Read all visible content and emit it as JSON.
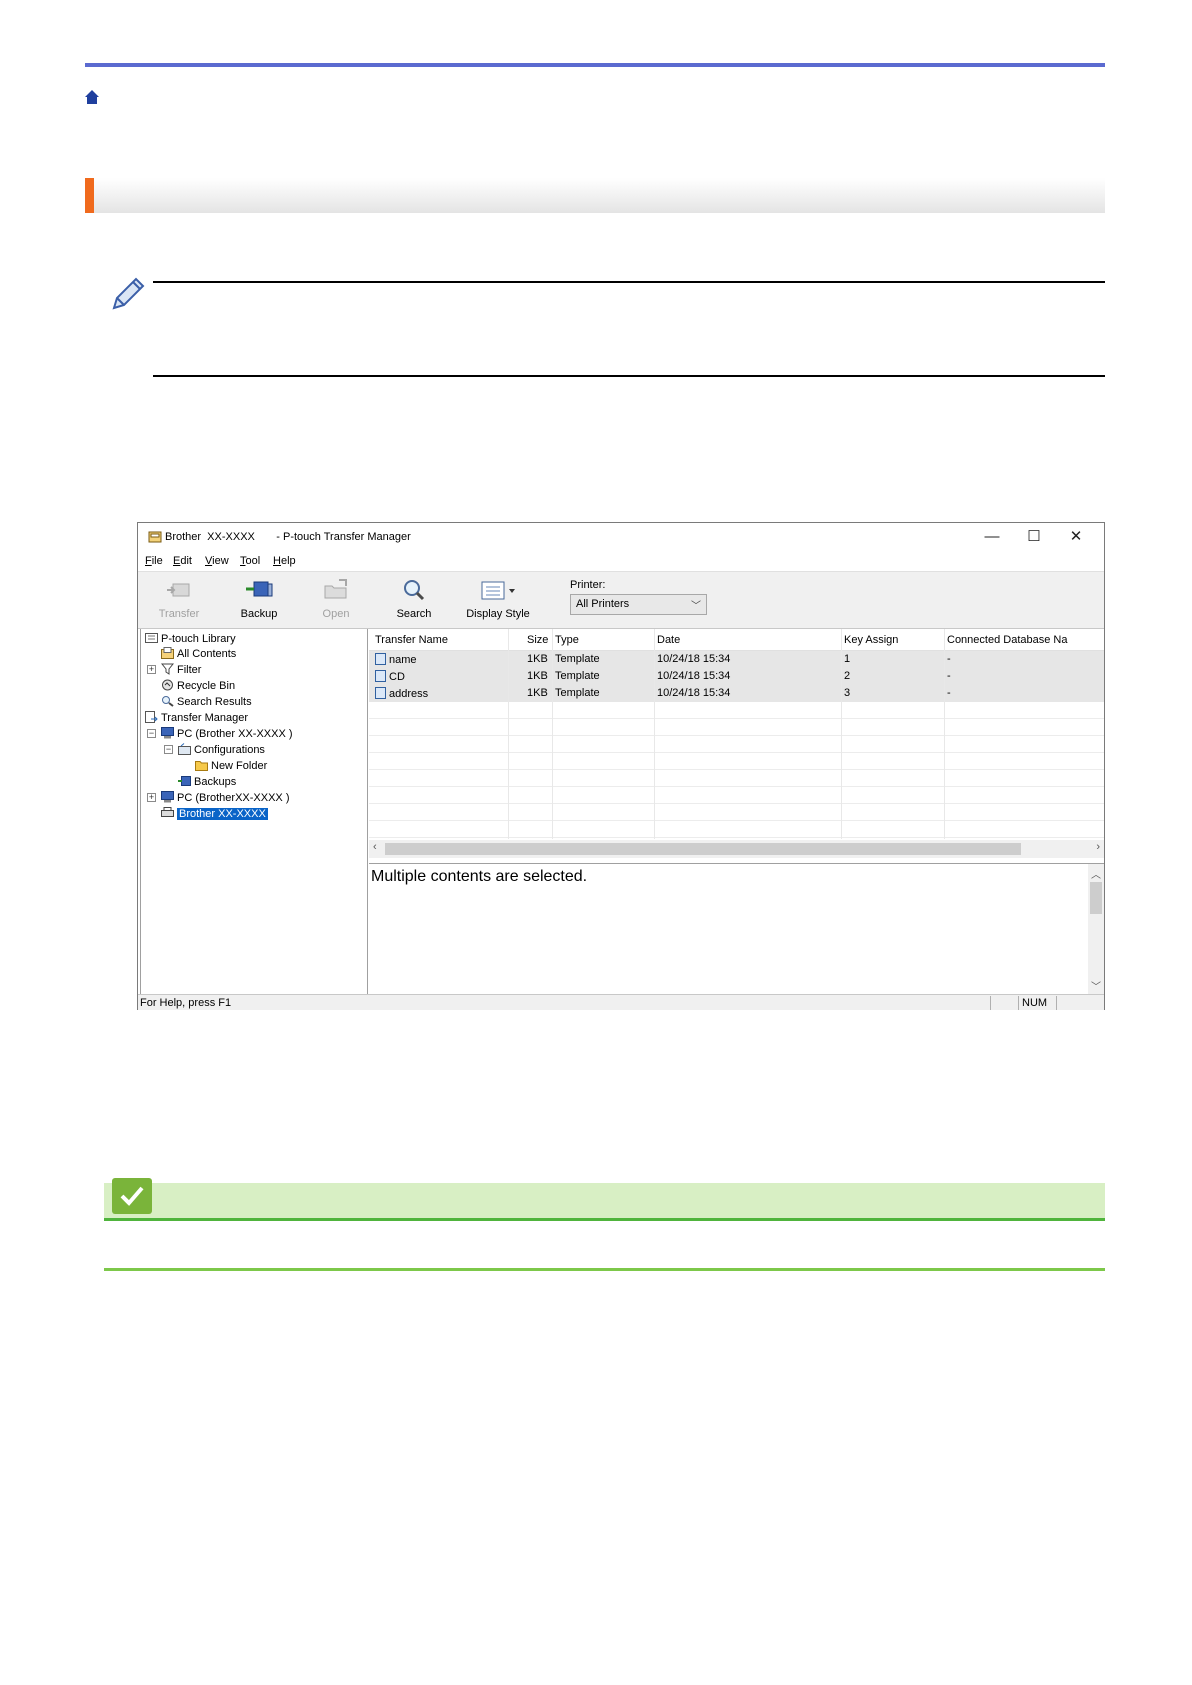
{
  "window": {
    "title": "Brother  XX-XXXX       - P-touch Transfer Manager",
    "controls": {
      "minimize": "—",
      "maximize": "☐",
      "close": "✕"
    }
  },
  "menu": [
    {
      "label": "File",
      "underline": "F",
      "rest": "ile"
    },
    {
      "label": "Edit",
      "underline": "E",
      "rest": "dit"
    },
    {
      "label": "View",
      "underline": "V",
      "rest": "iew"
    },
    {
      "label": "Tool",
      "underline": "T",
      "rest": "ool"
    },
    {
      "label": "Help",
      "underline": "H",
      "rest": "elp"
    }
  ],
  "toolbar": {
    "transfer": "Transfer",
    "backup": "Backup",
    "open": "Open",
    "search": "Search",
    "display_style": "Display Style",
    "printer_label": "Printer:",
    "printer_value": "All Printers"
  },
  "tree": {
    "library": "P-touch Library",
    "all_contents": "All Contents",
    "filter": "Filter",
    "recycle_bin": "Recycle Bin",
    "search_results": "Search Results",
    "transfer_manager": "Transfer Manager",
    "pc1": "PC (Brother  XX-XXXX      )",
    "configurations": "Configurations",
    "new_folder": "New Folder",
    "backups": "Backups",
    "pc2": "PC (BrotherXX-XXXX )",
    "printer": "Brother XX-XXXX"
  },
  "list": {
    "columns": [
      "Transfer Name",
      "Size",
      "Type",
      "Date",
      "Key Assign",
      "Connected Database Na"
    ],
    "rows": [
      {
        "name": "name",
        "size": "1KB",
        "type": "Template",
        "date": "10/24/18 15:34",
        "key": "1",
        "db": "-"
      },
      {
        "name": "CD",
        "size": "1KB",
        "type": "Template",
        "date": "10/24/18 15:34",
        "key": "2",
        "db": "-"
      },
      {
        "name": "address",
        "size": "1KB",
        "type": "Template",
        "date": "10/24/18 15:34",
        "key": "3",
        "db": "-"
      }
    ]
  },
  "detail": {
    "text": "Multiple contents are selected."
  },
  "status": {
    "help": "For Help, press F1",
    "num": "NUM"
  },
  "colors": {
    "accent_blue": "#5b6ad0",
    "section_orange": "#f06a1d",
    "related_green": "#4fb43c",
    "selection": "#0a64c8"
  }
}
